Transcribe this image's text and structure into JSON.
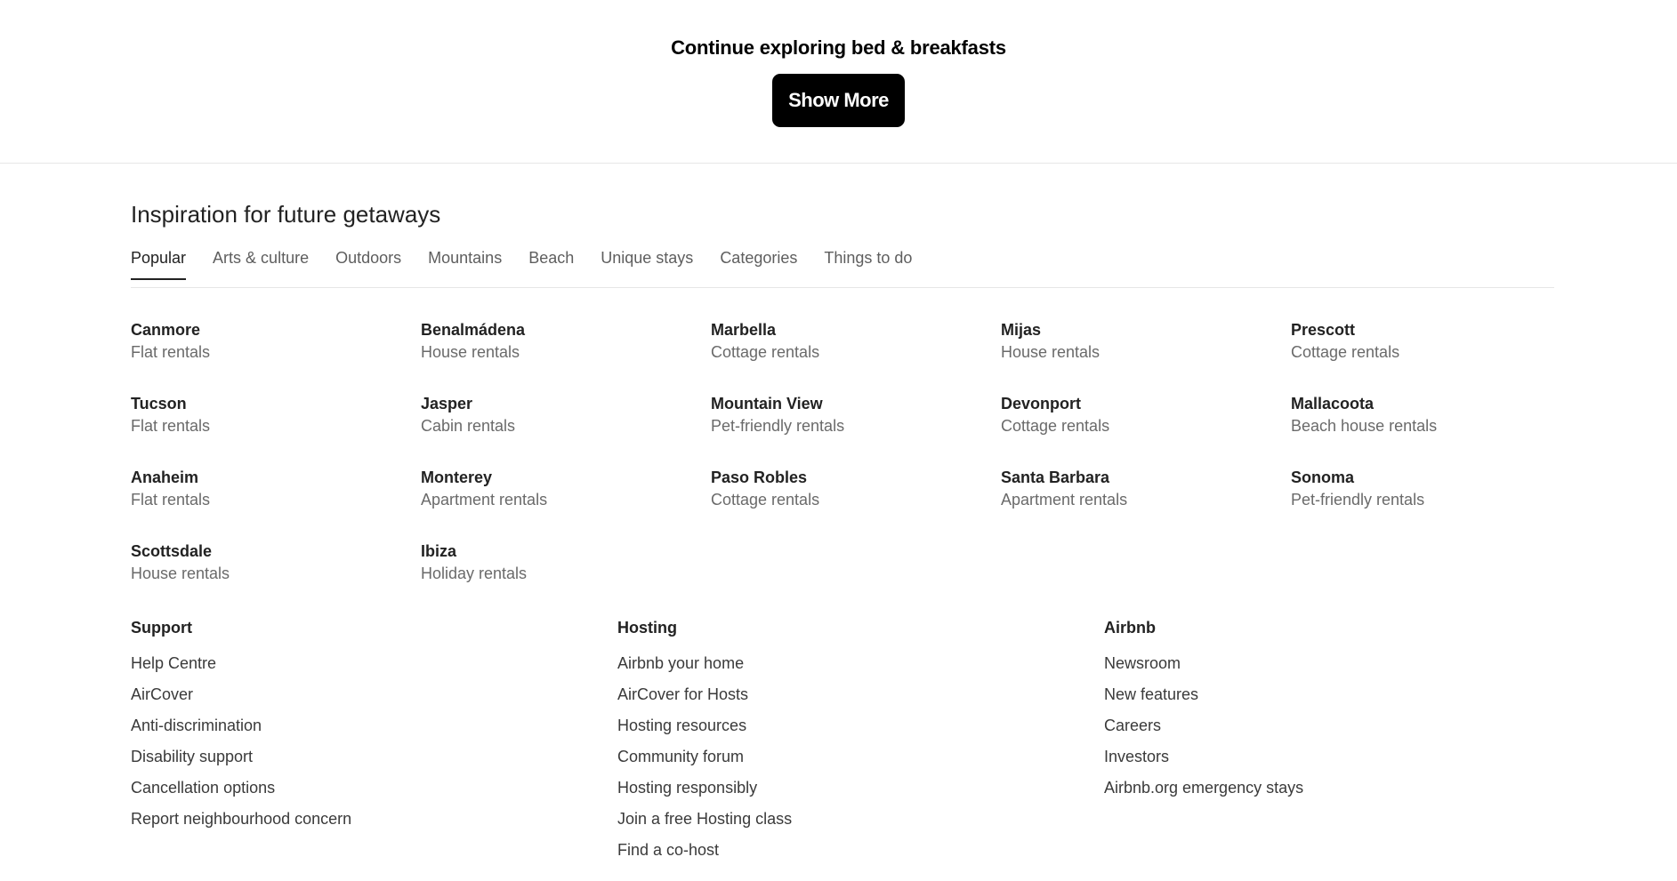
{
  "top": {
    "title": "Continue exploring bed & breakfasts",
    "show_more_label": "Show More"
  },
  "inspiration": {
    "title": "Inspiration for future getaways",
    "tabs": [
      {
        "label": "Popular",
        "active": true
      },
      {
        "label": "Arts & culture"
      },
      {
        "label": "Outdoors"
      },
      {
        "label": "Mountains"
      },
      {
        "label": "Beach"
      },
      {
        "label": "Unique stays"
      },
      {
        "label": "Categories"
      },
      {
        "label": "Things to do"
      }
    ],
    "destinations": [
      {
        "city": "Canmore",
        "type": "Flat rentals"
      },
      {
        "city": "Benalmádena",
        "type": "House rentals"
      },
      {
        "city": "Marbella",
        "type": "Cottage rentals"
      },
      {
        "city": "Mijas",
        "type": "House rentals"
      },
      {
        "city": "Prescott",
        "type": "Cottage rentals"
      },
      {
        "city": "Tucson",
        "type": "Flat rentals"
      },
      {
        "city": "Jasper",
        "type": "Cabin rentals"
      },
      {
        "city": "Mountain View",
        "type": "Pet-friendly rentals"
      },
      {
        "city": "Devonport",
        "type": "Cottage rentals"
      },
      {
        "city": "Mallacoota",
        "type": "Beach house rentals"
      },
      {
        "city": "Anaheim",
        "type": "Flat rentals"
      },
      {
        "city": "Monterey",
        "type": "Apartment rentals"
      },
      {
        "city": "Paso Robles",
        "type": "Cottage rentals"
      },
      {
        "city": "Santa Barbara",
        "type": "Apartment rentals"
      },
      {
        "city": "Sonoma",
        "type": "Pet-friendly rentals"
      },
      {
        "city": "Scottsdale",
        "type": "House rentals"
      },
      {
        "city": "Ibiza",
        "type": "Holiday rentals"
      }
    ]
  },
  "footer": {
    "columns": [
      {
        "heading": "Support",
        "links": [
          "Help Centre",
          "AirCover",
          "Anti-discrimination",
          "Disability support",
          "Cancellation options",
          "Report neighbourhood concern"
        ]
      },
      {
        "heading": "Hosting",
        "links": [
          "Airbnb your home",
          "AirCover for Hosts",
          "Hosting resources",
          "Community forum",
          "Hosting responsibly",
          "Join a free Hosting class",
          "Find a co-host"
        ]
      },
      {
        "heading": "Airbnb",
        "links": [
          "Newsroom",
          "New features",
          "Careers",
          "Investors",
          "Airbnb.org emergency stays"
        ]
      }
    ]
  }
}
